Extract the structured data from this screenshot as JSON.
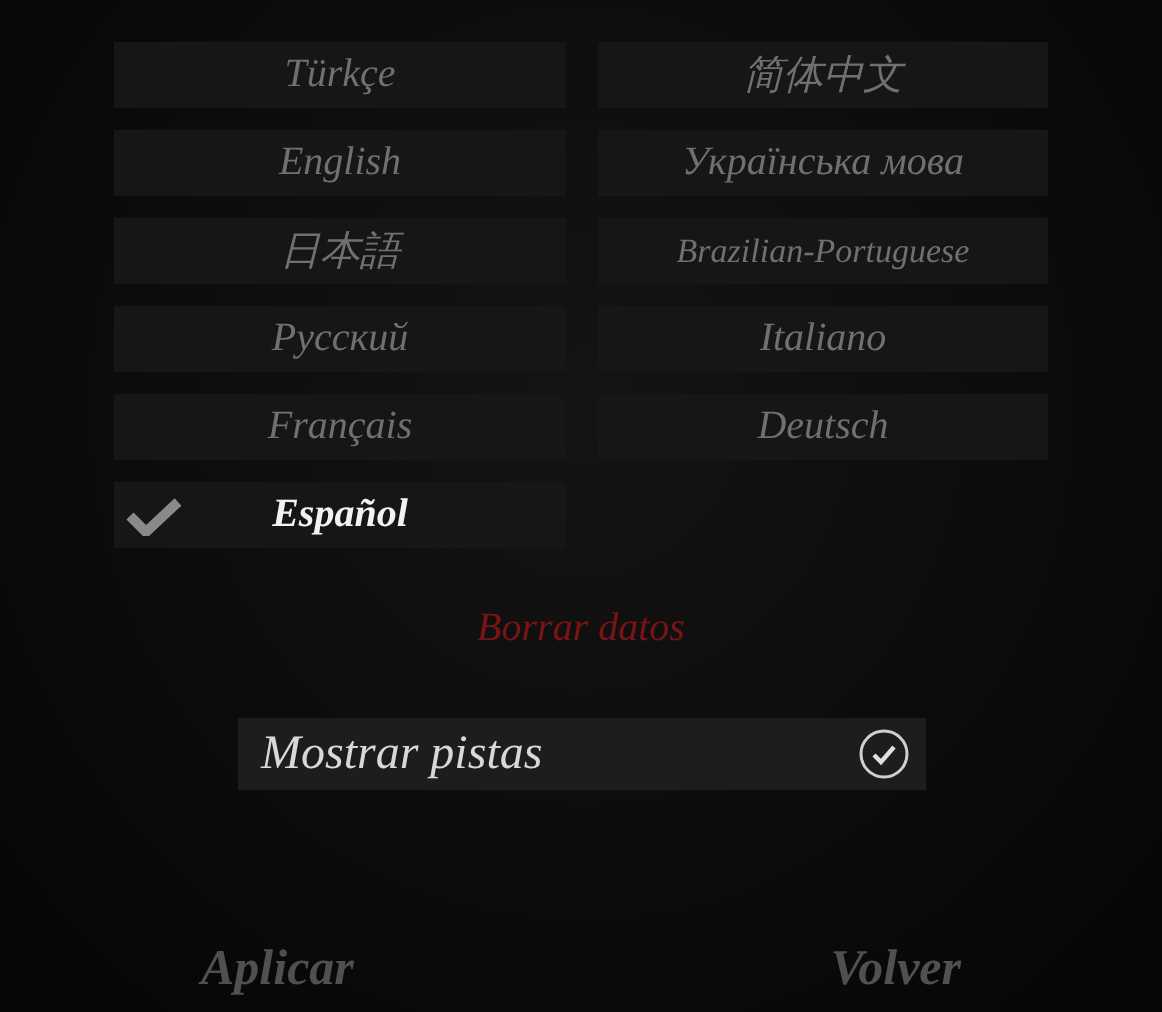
{
  "languages": [
    {
      "label": "Türkçe",
      "selected": false
    },
    {
      "label": "简体中文",
      "selected": false
    },
    {
      "label": "English",
      "selected": false
    },
    {
      "label": "Українська мова",
      "selected": false
    },
    {
      "label": "日本語",
      "selected": false
    },
    {
      "label": "Brazilian-Portuguese",
      "selected": false
    },
    {
      "label": "Русский",
      "selected": false
    },
    {
      "label": "Italiano",
      "selected": false
    },
    {
      "label": "Français",
      "selected": false
    },
    {
      "label": "Deutsch",
      "selected": false
    },
    {
      "label": "Español",
      "selected": true
    }
  ],
  "clear_data": "Borrar datos",
  "hints": {
    "label": "Mostrar pistas",
    "checked": true
  },
  "buttons": [
    "Aplicar",
    "Volver"
  ]
}
